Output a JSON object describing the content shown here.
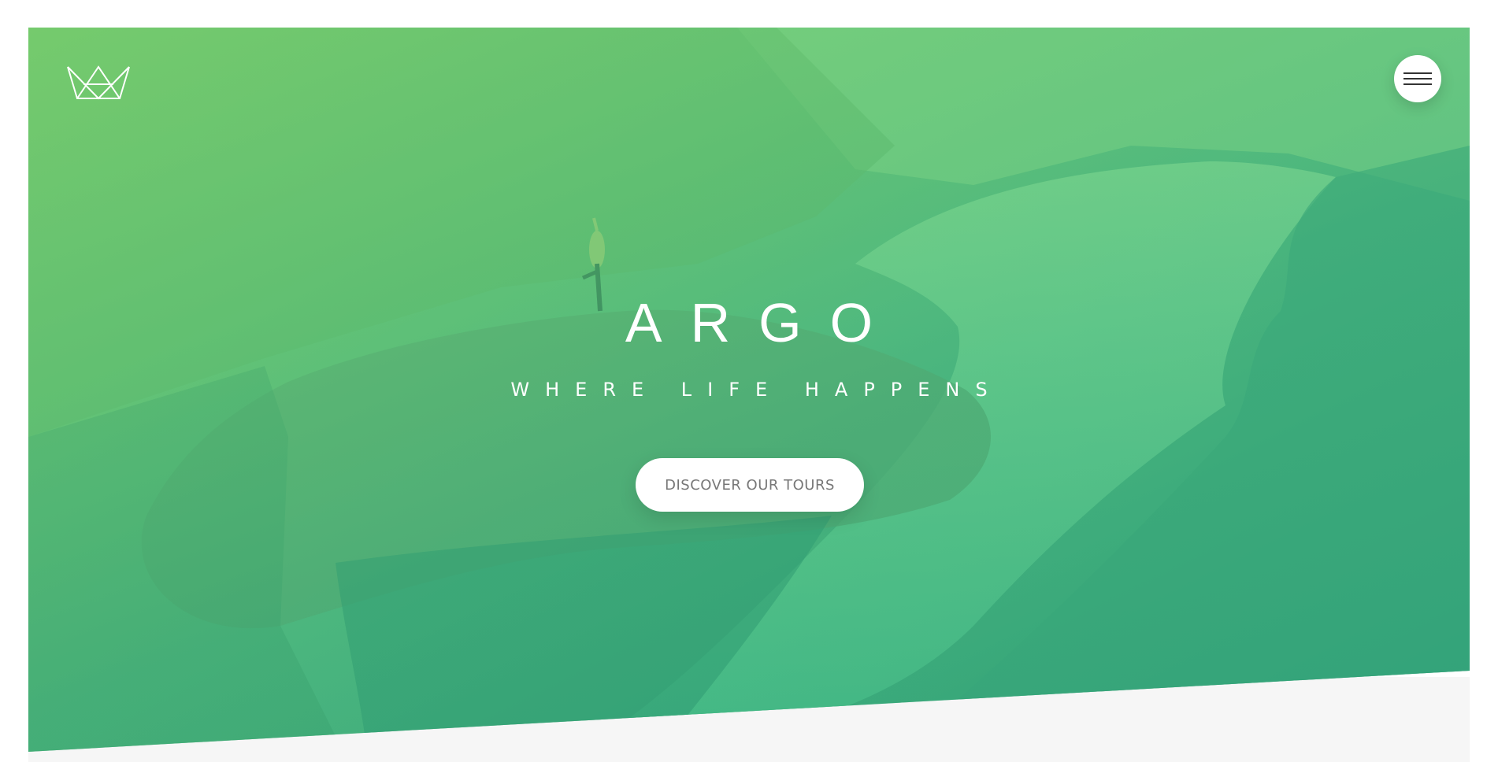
{
  "header": {
    "logo_icon": "crown-icon",
    "menu_icon": "hamburger-menu-icon"
  },
  "hero": {
    "title": "ARGO",
    "subtitle": "WHERE LIFE HAPPENS",
    "cta_label": "DISCOVER OUR TOURS",
    "background": "green-tinted mountain fjord photo"
  },
  "colors": {
    "accent_green_light": "#7ed56f",
    "accent_green_dark": "#28b485",
    "button_text": "#777777",
    "white": "#ffffff",
    "strip_gray": "#f6f6f6"
  }
}
